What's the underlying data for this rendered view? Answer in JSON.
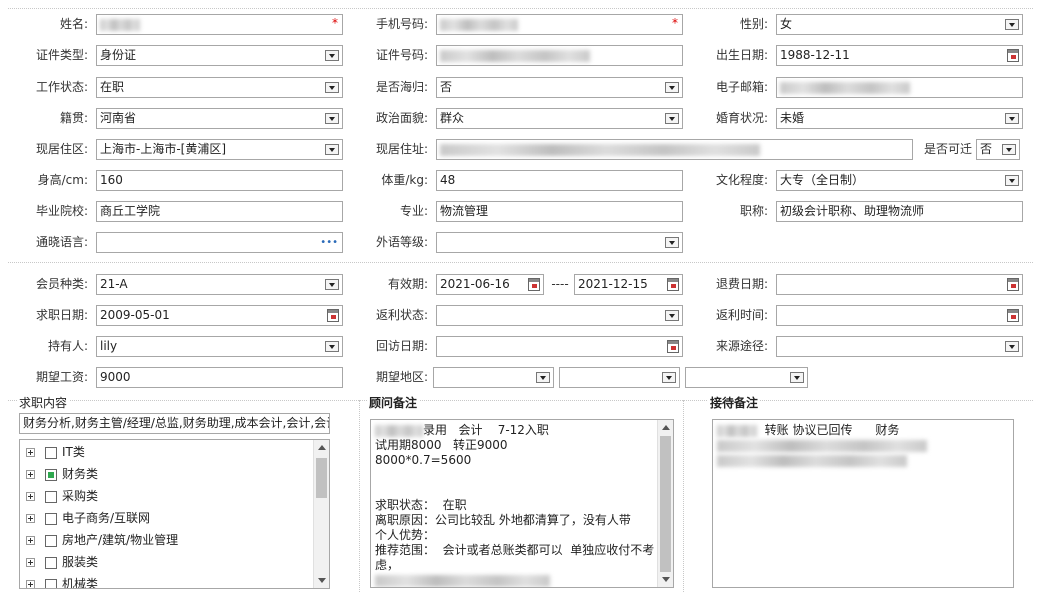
{
  "row1": {
    "name": {
      "label": "姓名:",
      "value": ""
    },
    "phone": {
      "label": "手机号码:",
      "value": ""
    },
    "gender": {
      "label": "性别:",
      "value": "女"
    }
  },
  "row2": {
    "id_type": {
      "label": "证件类型:",
      "value": "身份证"
    },
    "id_number": {
      "label": "证件号码:",
      "value": ""
    },
    "birth_date": {
      "label": "出生日期:",
      "value": "1988-12-11"
    }
  },
  "row3": {
    "work_status": {
      "label": "工作状态:",
      "value": "在职"
    },
    "returnee": {
      "label": "是否海归:",
      "value": "否"
    },
    "email": {
      "label": "电子邮箱:",
      "value": ""
    }
  },
  "row4": {
    "native_place": {
      "label": "籍贯:",
      "value": "河南省"
    },
    "political": {
      "label": "政治面貌:",
      "value": "群众"
    },
    "marital": {
      "label": "婚育状况:",
      "value": "未婚"
    }
  },
  "row5": {
    "region": {
      "label": "现居住区:",
      "value": "上海市-上海市-[黄浦区]"
    },
    "address": {
      "label": "现居住址:",
      "value": ""
    },
    "relocate": {
      "label": "是否可迁",
      "value": "否"
    }
  },
  "row6": {
    "height": {
      "label": "身高/cm:",
      "value": "160"
    },
    "weight": {
      "label": "体重/kg:",
      "value": "48"
    },
    "education": {
      "label": "文化程度:",
      "value": "大专（全日制）"
    }
  },
  "row7": {
    "school": {
      "label": "毕业院校:",
      "value": "商丘工学院"
    },
    "major": {
      "label": "专业:",
      "value": "物流管理"
    },
    "title": {
      "label": "职称:",
      "value": "初级会计职称、助理物流师"
    }
  },
  "row8": {
    "languages": {
      "label": "通晓语言:",
      "value": "",
      "more": "•••"
    },
    "foreign_level": {
      "label": "外语等级:",
      "value": ""
    }
  },
  "membership": {
    "member_type": {
      "label": "会员种类:",
      "value": "21-A"
    },
    "valid_period": {
      "label": "有效期:",
      "start": "2021-06-16",
      "sep": "----",
      "end": "2021-12-15"
    },
    "refund_date": {
      "label": "退费日期:",
      "value": ""
    },
    "job_date": {
      "label": "求职日期:",
      "value": "2009-05-01"
    },
    "rebate_status": {
      "label": "返利状态:",
      "value": ""
    },
    "rebate_time": {
      "label": "返利时间:",
      "value": ""
    },
    "holder": {
      "label": "持有人:",
      "value": "lily"
    },
    "revisit_date": {
      "label": "回访日期:",
      "value": ""
    },
    "source": {
      "label": "来源途径:",
      "value": ""
    },
    "expected_salary": {
      "label": "期望工资:",
      "value": "9000"
    },
    "expected_region": {
      "label": "期望地区:",
      "values": [
        "",
        "",
        ""
      ]
    }
  },
  "job_content": {
    "title": "求职内容",
    "summary": "财务分析,财务主管/经理/总监,财务助理,成本会计,会计,会计",
    "categories": [
      {
        "label": "IT类",
        "checked": false
      },
      {
        "label": "财务类",
        "checked": true
      },
      {
        "label": "采购类",
        "checked": false
      },
      {
        "label": "电子商务/互联网",
        "checked": false
      },
      {
        "label": "房地产/建筑/物业管理",
        "checked": false
      },
      {
        "label": "服装类",
        "checked": false
      },
      {
        "label": "机械类",
        "checked": false
      }
    ]
  },
  "advisor_notes": {
    "title": "顾问备注",
    "line1_suffix": "录用   会计    7-12入职",
    "line2": "试用期8000   转正9000",
    "line3": "8000*0.7=5600",
    "line4": "求职状态：  在职",
    "line5": "离职原因：公司比较乱 外地都清算了，没有人带",
    "line6": "个人优势：",
    "line7": "推荐范围：  会计或者总账类都可以  单独应收付不考",
    "line8": "虑，"
  },
  "reception_notes": {
    "title": "接待备注",
    "line1_suffix": "转账 协议已回传      财务"
  }
}
